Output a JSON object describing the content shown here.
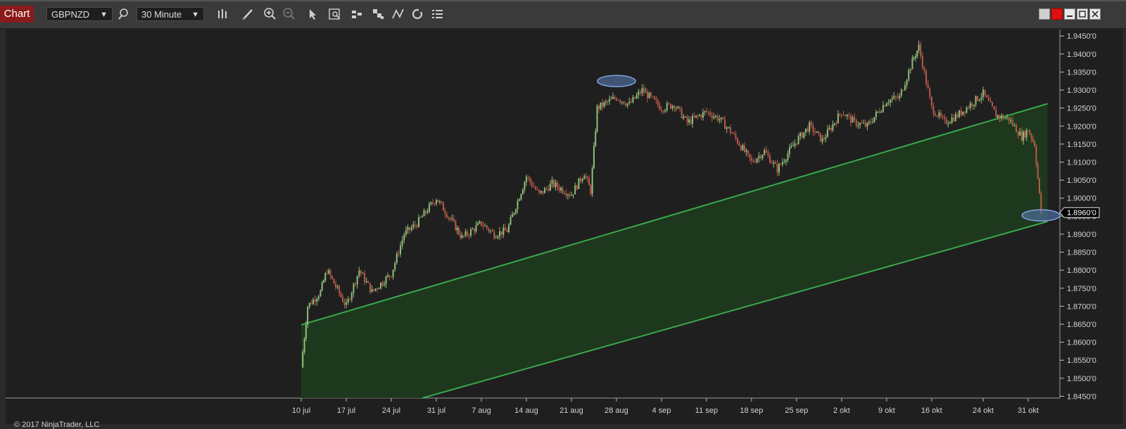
{
  "toolbar": {
    "chart_label": "Chart",
    "instrument": "GBPNZD",
    "interval": "30 Minute",
    "icons": [
      "search-icon",
      "bar-type-icon",
      "pencil-draw-icon",
      "zoom-in-icon",
      "zoom-out-icon",
      "pointer-icon",
      "data-box-icon",
      "indicators-icon",
      "strategies-icon",
      "drawing-tools-icon",
      "refresh-icon",
      "properties-icon"
    ],
    "window_icons": [
      "restore-icon",
      "close-icon",
      "minimize-icon",
      "maximize-icon",
      "close-window-icon"
    ]
  },
  "colors": {
    "background": "#1f1f1f",
    "up_candle": "#8fbf7a",
    "down_candle": "#b95a4a",
    "channel_line": "#3aa84a",
    "channel_fill": "#1f3a1f",
    "ellipse": "#5b7fbf",
    "chart_tab": "#8b1a1a"
  },
  "copyright": "© 2017 NinjaTrader, LLC",
  "chart_data": {
    "type": "candlestick",
    "instrument": "GBPNZD",
    "interval": "30 Minute",
    "x_tick_labels": [
      "10 jul",
      "17 jul",
      "24 jul",
      "31 jul",
      "7 aug",
      "14 aug",
      "21 aug",
      "28 aug",
      "4 sep",
      "11 sep",
      "18 sep",
      "25 sep",
      "2 okt",
      "9 okt",
      "16 okt",
      "24 okt",
      "31 okt"
    ],
    "y_tick_labels": [
      "1.9450'0",
      "1.9400'0",
      "1.9350'0",
      "1.9300'0",
      "1.9250'0",
      "1.9200'0",
      "1.9150'0",
      "1.9100'0",
      "1.9050'0",
      "1.9000'0",
      "1.8950'0",
      "1.8900'0",
      "1.8850'0",
      "1.8800'0",
      "1.8750'0",
      "1.8700'0",
      "1.8650'0",
      "1.8600'0",
      "1.8550'0",
      "1.8500'0",
      "1.8450'0"
    ],
    "ylim": [
      1.8445,
      1.9468
    ],
    "last_price": "1.8960'0",
    "price_path": [
      [
        "10 jul",
        1.853
      ],
      [
        "11 jul",
        1.87
      ],
      [
        "13 jul",
        1.874
      ],
      [
        "14 jul",
        1.88
      ],
      [
        "17 jul",
        1.87
      ],
      [
        "19 jul",
        1.88
      ],
      [
        "21 jul",
        1.874
      ],
      [
        "24 jul",
        1.879
      ],
      [
        "26 jul",
        1.89
      ],
      [
        "28 jul",
        1.893
      ],
      [
        "31 jul",
        1.9
      ],
      [
        "3 aug",
        1.892
      ],
      [
        "4 aug",
        1.889
      ],
      [
        "7 aug",
        1.893
      ],
      [
        "9 aug",
        1.89
      ],
      [
        "11 aug",
        1.891
      ],
      [
        "14 aug",
        1.906
      ],
      [
        "16 aug",
        1.901
      ],
      [
        "18 aug",
        1.904
      ],
      [
        "21 aug",
        1.901
      ],
      [
        "23 aug",
        1.907
      ],
      [
        "24 aug",
        1.902
      ],
      [
        "25 aug",
        1.925
      ],
      [
        "28 aug",
        1.928
      ],
      [
        "30 aug",
        1.926
      ],
      [
        "1 sep",
        1.93
      ],
      [
        "4 sep",
        1.925
      ],
      [
        "6 sep",
        1.926
      ],
      [
        "8 sep",
        1.921
      ],
      [
        "11 sep",
        1.924
      ],
      [
        "13 sep",
        1.922
      ],
      [
        "15 sep",
        1.918
      ],
      [
        "18 sep",
        1.91
      ],
      [
        "20 sep",
        1.913
      ],
      [
        "22 sep",
        1.908
      ],
      [
        "25 sep",
        1.916
      ],
      [
        "27 sep",
        1.92
      ],
      [
        "29 sep",
        1.916
      ],
      [
        "2 okt",
        1.924
      ],
      [
        "4 okt",
        1.921
      ],
      [
        "6 okt",
        1.92
      ],
      [
        "9 okt",
        1.927
      ],
      [
        "11 okt",
        1.928
      ],
      [
        "13 okt",
        1.938
      ],
      [
        "14 okt",
        1.942
      ],
      [
        "16 okt",
        1.925
      ],
      [
        "18 okt",
        1.921
      ],
      [
        "20 okt",
        1.923
      ],
      [
        "24 okt",
        1.929
      ],
      [
        "26 okt",
        1.923
      ],
      [
        "28 okt",
        1.922
      ],
      [
        "30 okt",
        1.917
      ],
      [
        "31 okt",
        1.919
      ],
      [
        "1 nov",
        1.915
      ],
      [
        "2 nov",
        1.896
      ]
    ],
    "channel": {
      "upper": [
        [
          "10 jul",
          1.8648
        ],
        [
          "3 nov",
          1.9262
        ]
      ],
      "lower": [
        [
          "10 jul",
          1.835
        ],
        [
          "3 nov",
          1.8935
        ]
      ]
    },
    "annotations": [
      {
        "type": "ellipse",
        "at": [
          "28 aug",
          1.9325
        ]
      },
      {
        "type": "ellipse",
        "at": [
          "2 nov",
          1.8952
        ]
      }
    ]
  }
}
